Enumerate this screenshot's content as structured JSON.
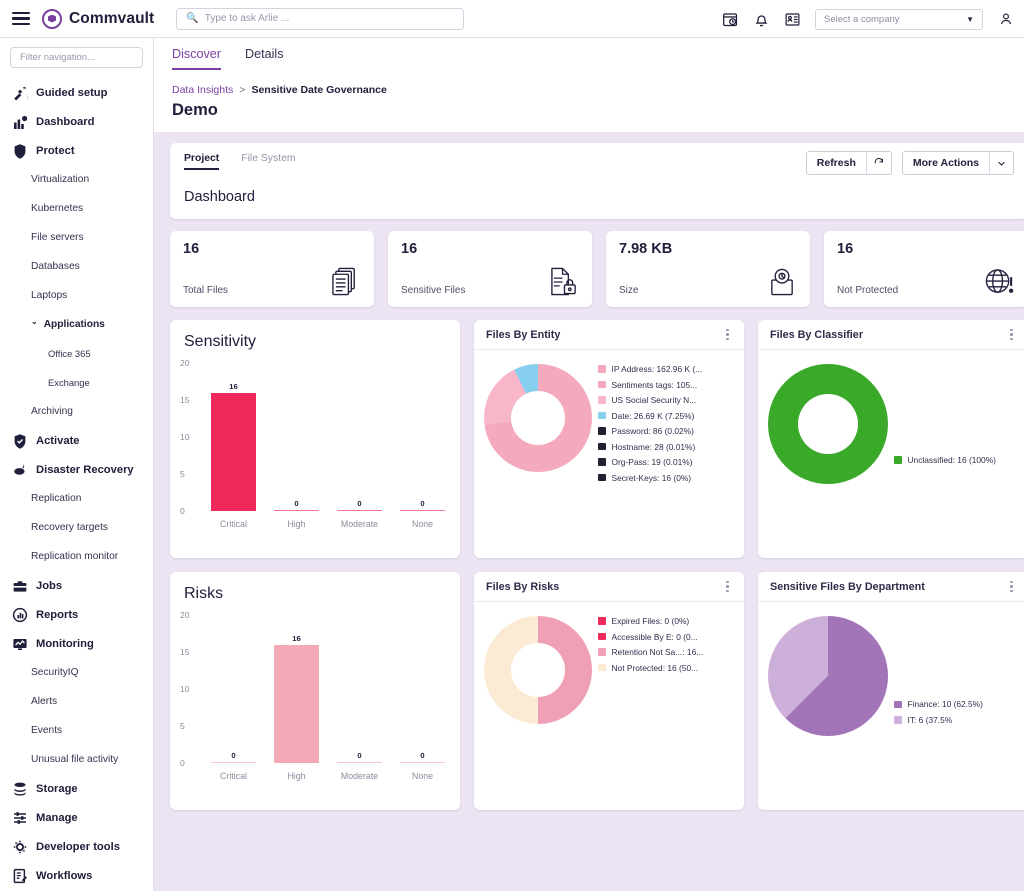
{
  "topbar": {
    "brand": "Commvault",
    "search_placeholder": "Type to ask Arlie ...",
    "company_select_value": "Select a company",
    "icons": [
      "hamburger-icon",
      "calendar-clock-icon",
      "bell-icon",
      "id-card-icon",
      "user-avatar-icon"
    ]
  },
  "sidebar": {
    "filter_placeholder": "Filter navigation...",
    "items": [
      {
        "label": "Guided setup",
        "level": 0,
        "icon": "guided-setup-icon"
      },
      {
        "label": "Dashboard",
        "level": 0,
        "icon": "dashboard-icon"
      },
      {
        "label": "Protect",
        "level": 0,
        "icon": "shield-protect-icon"
      },
      {
        "label": "Virtualization",
        "level": 1,
        "icon": ""
      },
      {
        "label": "Kubernetes",
        "level": 1,
        "icon": ""
      },
      {
        "label": "File servers",
        "level": 1,
        "icon": ""
      },
      {
        "label": "Databases",
        "level": 1,
        "icon": ""
      },
      {
        "label": "Laptops",
        "level": 1,
        "icon": ""
      },
      {
        "label": "Applications",
        "level": 1,
        "icon": "chevron-down-icon",
        "expandable": true
      },
      {
        "label": "Office 365",
        "level": 2,
        "icon": ""
      },
      {
        "label": "Exchange",
        "level": 2,
        "icon": ""
      },
      {
        "label": "Archiving",
        "level": 1,
        "icon": ""
      },
      {
        "label": "Activate",
        "level": 0,
        "icon": "activate-shield-icon"
      },
      {
        "label": "Disaster Recovery",
        "level": 0,
        "icon": "disaster-recovery-icon"
      },
      {
        "label": "Replication",
        "level": 1,
        "icon": ""
      },
      {
        "label": "Recovery targets",
        "level": 1,
        "icon": ""
      },
      {
        "label": "Replication monitor",
        "level": 1,
        "icon": ""
      },
      {
        "label": "Jobs",
        "level": 0,
        "icon": "briefcase-icon"
      },
      {
        "label": "Reports",
        "level": 0,
        "icon": "reports-icon"
      },
      {
        "label": "Monitoring",
        "level": 0,
        "icon": "monitor-icon"
      },
      {
        "label": "SecurityIQ",
        "level": 1,
        "icon": ""
      },
      {
        "label": "Alerts",
        "level": 1,
        "icon": ""
      },
      {
        "label": "Events",
        "level": 1,
        "icon": ""
      },
      {
        "label": "Unusual file activity",
        "level": 1,
        "icon": ""
      },
      {
        "label": "Storage",
        "level": 0,
        "icon": "storage-icon"
      },
      {
        "label": "Manage",
        "level": 0,
        "icon": "sliders-icon"
      },
      {
        "label": "Developer tools",
        "level": 0,
        "icon": "developer-tools-icon"
      },
      {
        "label": "Workflows",
        "level": 0,
        "icon": "workflows-icon"
      }
    ]
  },
  "main": {
    "tabs": [
      {
        "label": "Discover",
        "active": true
      },
      {
        "label": "Details",
        "active": false
      }
    ],
    "breadcrumb": {
      "parent": "Data Insights",
      "separator": ">",
      "current": "Sensitive Date Governance"
    },
    "page_title": "Demo"
  },
  "toolbar": {
    "sub_tabs": [
      {
        "label": "Project",
        "active": true
      },
      {
        "label": "File System",
        "active": false
      }
    ],
    "refresh_label": "Refresh",
    "refresh_icon": "refresh-icon",
    "more_actions_label": "More Actions",
    "more_actions_icon": "chevron-down-icon",
    "dashboard_label": "Dashboard"
  },
  "kpis": [
    {
      "value": "16",
      "label": "Total Files",
      "icon": "files-stack-icon"
    },
    {
      "value": "16",
      "label": "Sensitive Files",
      "icon": "file-lock-icon"
    },
    {
      "value": "7.98 KB",
      "label": "Size",
      "icon": "size-gauge-icon"
    },
    {
      "value": "16",
      "label": "Not Protected",
      "icon": "globe-alert-icon"
    }
  ],
  "colors": {
    "accent_purple": "#7b3fa0",
    "page_bg": "#ece4f2",
    "crimson": "#ee2a5b",
    "pink": "#f4a9b8",
    "pink_light": "#f7b9c8",
    "sky": "#87cfee",
    "dark_navy": "#241f33",
    "green": "#3aa92a",
    "cream": "#fbebd4",
    "purple_dark": "#a274b8",
    "purple_light": "#cdb0da"
  },
  "chart_data": [
    {
      "id": "sensitivity",
      "type": "bar",
      "title": "Sensitivity",
      "categories": [
        "Critical",
        "High",
        "Moderate",
        "None"
      ],
      "values": [
        16,
        0,
        0,
        0
      ],
      "ylabel": "",
      "xlabel": "",
      "ylim": [
        0,
        20
      ],
      "yticks": [
        0,
        5,
        10,
        15,
        20
      ],
      "grid": false,
      "bar_color": "#ee2a5b",
      "data_labels": [
        "16",
        "0",
        "0",
        "0"
      ]
    },
    {
      "id": "files-by-entity",
      "type": "pie",
      "title": "Files By Entity",
      "donut": true,
      "legend_position": "right",
      "labels": [
        "IP Address: 162.96 K (...",
        "Sentiments tags: 105...",
        "US Social Security N...",
        "Date: 26.69 K (7.25%)",
        "Password: 86 (0.02%)",
        "Hostname: 28 (0.01%)",
        "Org-Pass: 19 (0.01%)",
        "Secret-Keys: 16 (0%)"
      ],
      "values": [
        162960,
        105000,
        73000,
        26690,
        86,
        28,
        19,
        16
      ],
      "slice_percents": [
        44.3,
        28.5,
        19.9,
        7.25,
        0.02,
        0.01,
        0.01,
        0.0
      ],
      "colors": [
        "#f4a9bd",
        "#f4a9bd",
        "#f7b7c8",
        "#87cfee",
        "#241f33",
        "#241f33",
        "#241f33",
        "#241f33"
      ]
    },
    {
      "id": "files-by-classifier",
      "type": "pie",
      "title": "Files By Classifier",
      "donut": true,
      "legend_position": "right",
      "labels": [
        "Unclassified: 16 (100%)"
      ],
      "values": [
        16
      ],
      "slice_percents": [
        100
      ],
      "colors": [
        "#3aa92a"
      ]
    },
    {
      "id": "risks",
      "type": "bar",
      "title": "Risks",
      "categories": [
        "Critical",
        "High",
        "Moderate",
        "None"
      ],
      "values": [
        0,
        16,
        0,
        0
      ],
      "ylabel": "",
      "xlabel": "",
      "ylim": [
        0,
        20
      ],
      "yticks": [
        0,
        5,
        10,
        15,
        20
      ],
      "grid": false,
      "bar_color": "#f4a9b8",
      "data_labels": [
        "0",
        "16",
        "0",
        "0"
      ]
    },
    {
      "id": "files-by-risks",
      "type": "pie",
      "title": "Files By Risks",
      "donut": true,
      "legend_position": "right",
      "labels": [
        "Expired Files: 0 (0%)",
        "Accessible By E: 0 (0...",
        "Retention Not Sa...: 16...",
        "Not Protected: 16 (50..."
      ],
      "values": [
        0,
        0,
        16,
        16
      ],
      "slice_percents": [
        0,
        0,
        50,
        50
      ],
      "colors": [
        "#ee2a5b",
        "#ee2a5b",
        "#f0a0b4",
        "#fbebd4"
      ]
    },
    {
      "id": "sensitive-files-by-department",
      "type": "pie",
      "title": "Sensitive Files By Department",
      "donut": false,
      "legend_position": "right",
      "labels": [
        "Finance: 10 (62.5%)",
        "IT: 6 (37.5%"
      ],
      "values": [
        10,
        6
      ],
      "slice_percents": [
        62.5,
        37.5
      ],
      "colors": [
        "#a274b8",
        "#cdb0da"
      ]
    }
  ]
}
